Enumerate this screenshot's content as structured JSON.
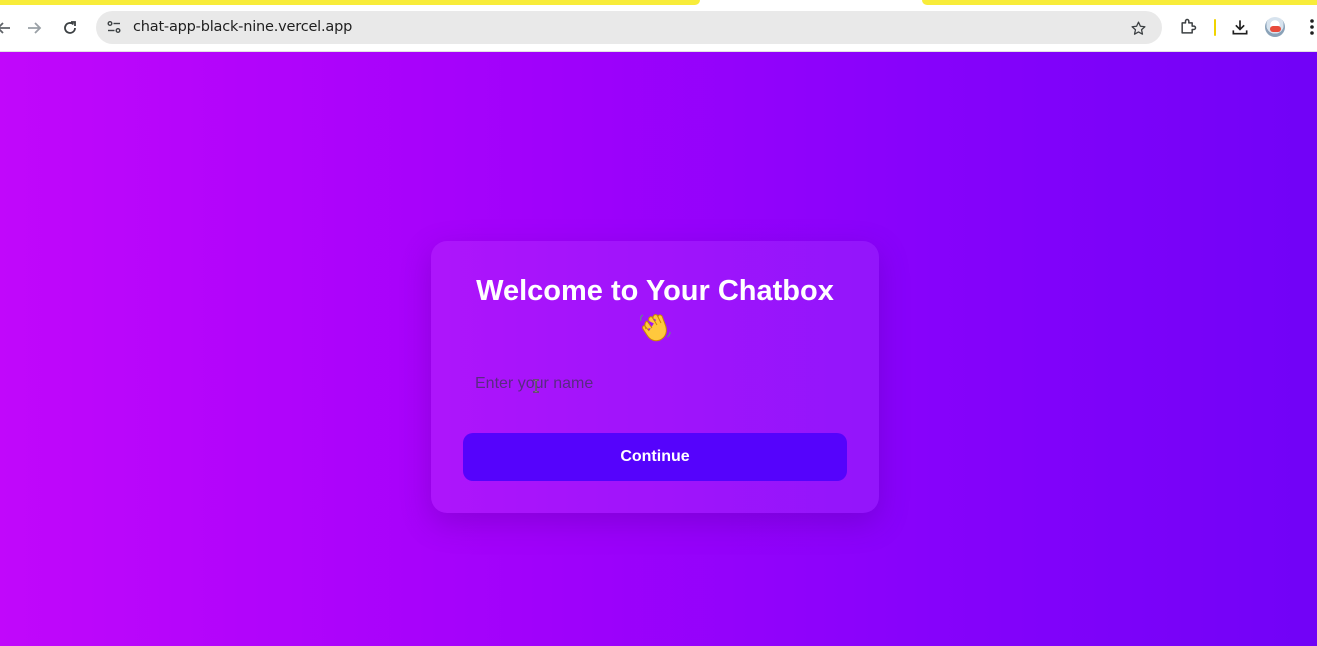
{
  "browser": {
    "url": "chat-app-black-nine.vercel.app",
    "icons": [
      "back-icon",
      "forward-icon",
      "reload-icon",
      "site-info-icon",
      "bookmark-star-icon",
      "extensions-icon",
      "download-icon",
      "profile-avatar",
      "more-menu-icon"
    ]
  },
  "colors": {
    "gradient_start": "#c107fb",
    "gradient_end": "#7102f7",
    "button": "#5503fc",
    "tab_highlight": "#f8ec3a"
  },
  "card": {
    "title": "Welcome to Your Chatbox",
    "emoji_icon": "waving-hand-icon",
    "input_placeholder": "Enter your name",
    "input_value": "",
    "button_label": "Continue"
  }
}
